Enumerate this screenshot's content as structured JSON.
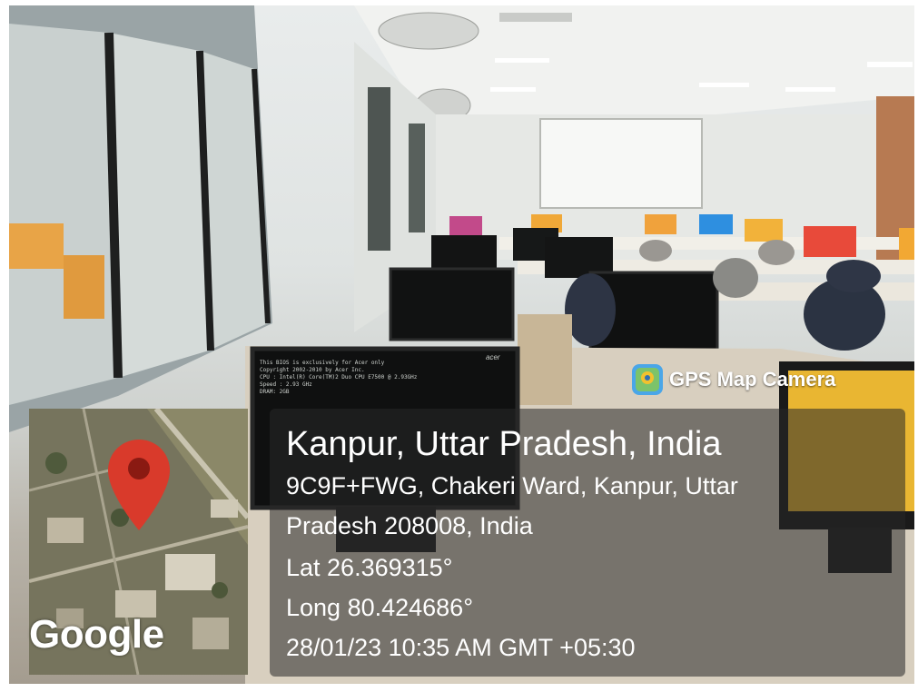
{
  "overlay": {
    "app_badge": {
      "icon": "gps-map-camera-app-icon",
      "label": "GPS Map Camera"
    },
    "map_thumbnail": {
      "logo": "Google",
      "marker_color": "#d93a2b"
    },
    "location": {
      "title": "Kanpur, Uttar Pradesh, India",
      "address_line1": "9C9F+FWG, Chakeri Ward, Kanpur, Uttar",
      "address_line2": "Pradesh 208008, India",
      "lat": "Lat 26.369315°",
      "long": "Long 80.424686°",
      "datetime": "28/01/23 10:35 AM GMT +05:30"
    }
  },
  "scene": {
    "description_type": "computer-lab",
    "monitor_boot_text": [
      "This BIOS is exclusively for Acer only",
      "Copyright 2002-2010 by Acer Inc.",
      "CPU : Intel(R) Core(TM)2 Duo CPU E7500 @ 2.93GHz",
      "Speed : 2.93 GHz",
      "DRAM: 2GB"
    ],
    "monitor_brand": "acer"
  }
}
